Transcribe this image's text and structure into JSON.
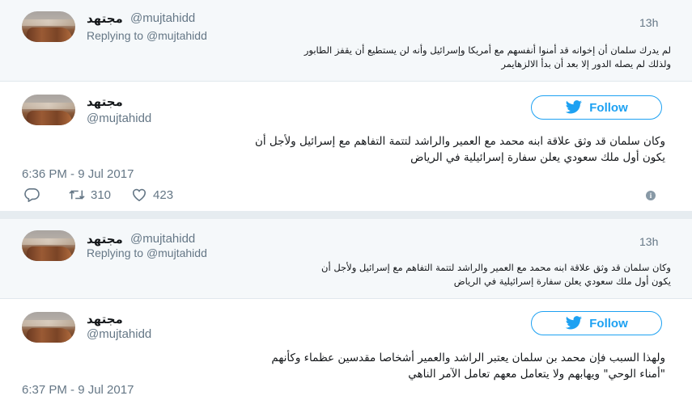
{
  "tweets": [
    {
      "type": "reply",
      "name": "مجتهد",
      "handle": "@mujtahidd",
      "time": "13h",
      "replying_label": "Replying to",
      "replying_handle": "@mujtahidd",
      "text_line1": "لم يدرك سلمان أن إخوانه قد أمنوا أنفسهم مع أمريكا وإسرائيل وأنه لن يستطيع أن يقفز الطابور",
      "text_line2": "ولذلك لم يصله الدور إلا بعد أن بدأ الالزهايمر"
    },
    {
      "type": "main",
      "name": "مجتهد",
      "handle": "@mujtahidd",
      "follow_label": "Follow",
      "text_line1": "وكان سلمان قد وثق علاقة ابنه محمد مع العمير والراشد لتتمة التفاهم مع إسرائيل ولأجل أن",
      "text_line2": "يكون أول ملك سعودي يعلن سفارة إسرائيلية في الرياض",
      "timestamp": "6:36 PM - 9 Jul 2017",
      "retweets": "310",
      "likes": "423"
    },
    {
      "type": "reply",
      "name": "مجتهد",
      "handle": "@mujtahidd",
      "time": "13h",
      "replying_label": "Replying to",
      "replying_handle": "@mujtahidd",
      "text_line1": "وكان سلمان قد وثق علاقة ابنه محمد مع العمير والراشد لتتمة التفاهم مع إسرائيل ولأجل أن",
      "text_line2": "يكون أول ملك سعودي يعلن سفارة إسرائيلية في الرياض"
    },
    {
      "type": "main",
      "name": "مجتهد",
      "handle": "@mujtahidd",
      "follow_label": "Follow",
      "text_line1": "ولهذا السبب فإن محمد بن سلمان يعتبر الراشد والعمير أشخاصا مقدسين عظماء وكأنهم",
      "text_line2": "\"أمناء الوحي\" ويهابهم ولا يتعامل معهم تعامل الآمر الناهي",
      "timestamp": "6:37 PM - 9 Jul 2017"
    }
  ],
  "colors": {
    "accent": "#1da1f2",
    "muted": "#657786",
    "reply_bg": "#f5f8fa",
    "page_bg": "#e6ecf0"
  },
  "icons": [
    "reply-icon",
    "retweet-icon",
    "heart-icon",
    "info-icon",
    "twitter-bird-icon"
  ]
}
